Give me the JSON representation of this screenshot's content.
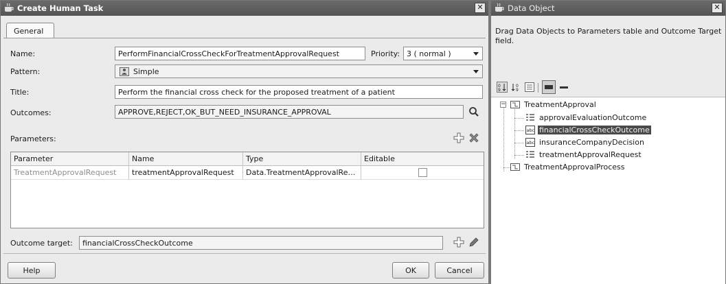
{
  "left_dialog": {
    "title": "Create Human Task",
    "close_label": "✕",
    "tab_general": "General",
    "name_label": "Name:",
    "name_value": "PerformFinancialCrossCheckForTreatmentApprovalRequest",
    "priority_label": "Priority:",
    "priority_value": "3 ( normal )",
    "pattern_label": "Pattern:",
    "pattern_value": "Simple",
    "title_label": "Title:",
    "title_value": "Perform the financial cross check for the proposed treatment of a patient",
    "outcomes_label": "Outcomes:",
    "outcomes_value": "APPROVE,REJECT,OK_BUT_NEED_INSURANCE_APPROVAL",
    "parameters_label": "Parameters:",
    "table": {
      "headers": [
        "Parameter",
        "Name",
        "Type",
        "Editable"
      ],
      "rows": [
        {
          "parameter": "TreatmentApprovalRequest",
          "name": "treatmentApprovalRequest",
          "type": "Data.TreatmentApprovalRe…",
          "editable": false
        }
      ]
    },
    "outcome_target_label": "Outcome target:",
    "outcome_target_value": "financialCrossCheckOutcome",
    "help_button": "Help",
    "ok_button": "OK",
    "cancel_button": "Cancel"
  },
  "right_panel": {
    "title": "Data Object",
    "close_label": "✕",
    "instructions": "Drag Data Objects to Parameters table and Outcome Target field.",
    "tree": {
      "root": "TreatmentApproval",
      "children": [
        "approvalEvaluationOutcome",
        "financialCrossCheckOutcome",
        "insuranceCompanyDecision",
        "treatmentApprovalRequest"
      ],
      "selected_child": "financialCrossCheckOutcome",
      "sibling_root": "TreatmentApprovalProcess"
    }
  },
  "icons": {
    "window": "coffee-cup-icon",
    "search": "search-icon",
    "add": "plus-icon",
    "remove": "x-icon",
    "edit": "pencil-icon",
    "pattern": "simple-pattern-icon"
  },
  "colors": {
    "titlebar": "#555555",
    "panel": "#ebebeb",
    "selection": "#4a4a4a"
  }
}
